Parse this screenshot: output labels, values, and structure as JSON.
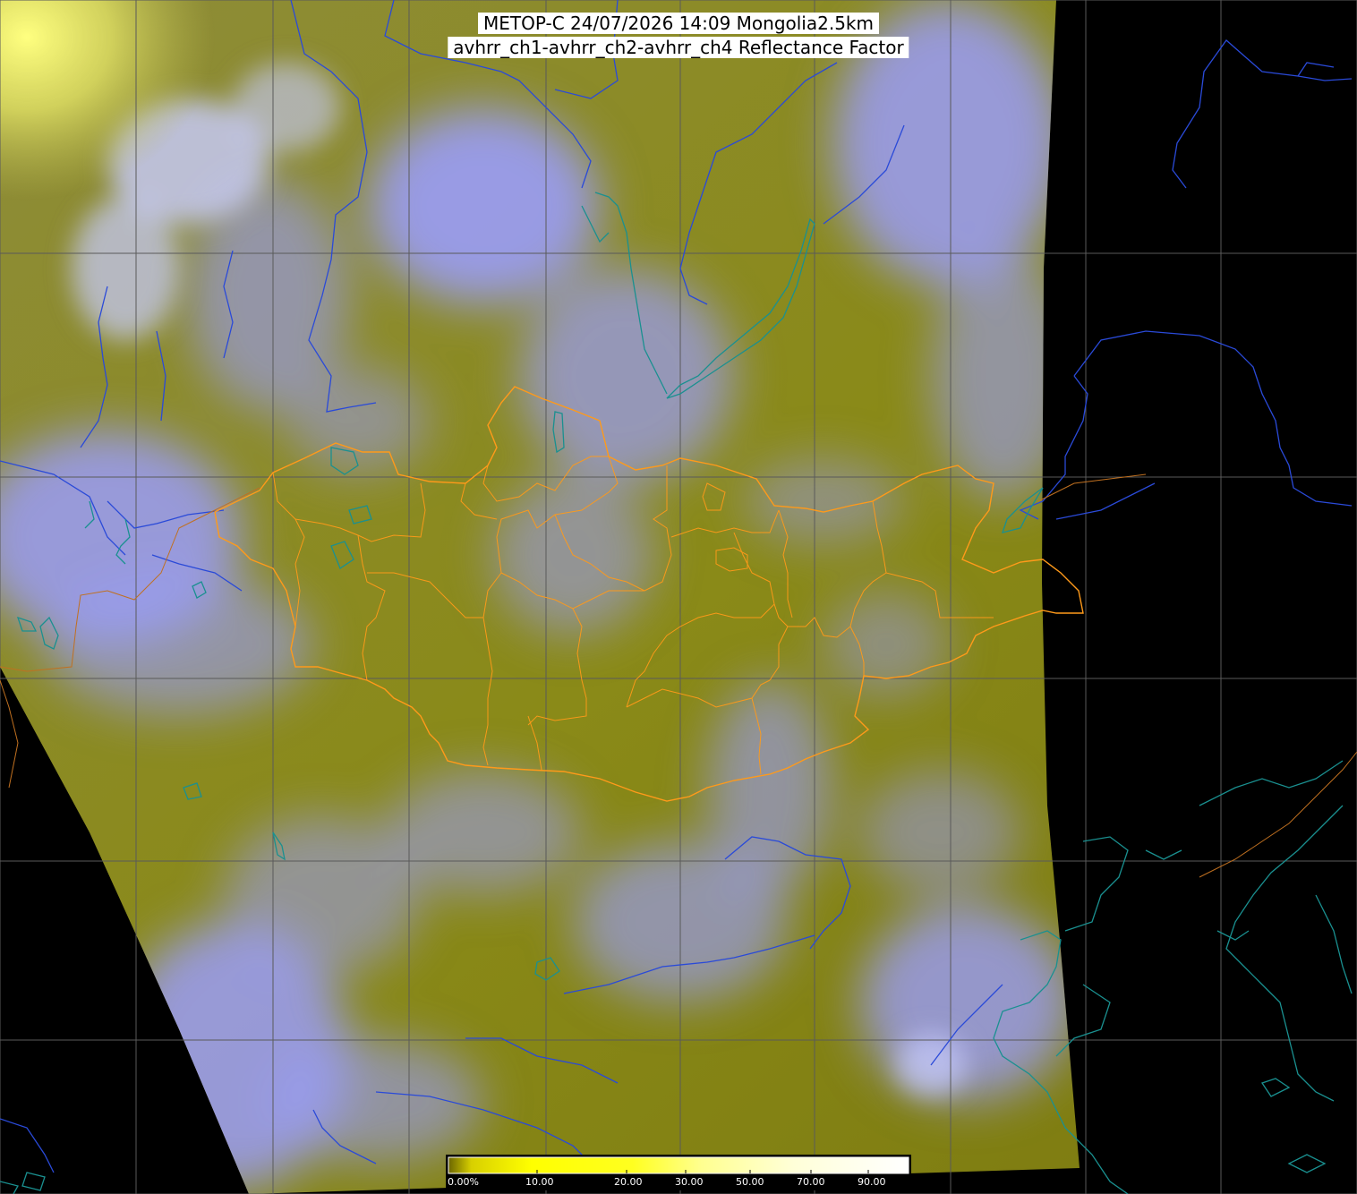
{
  "title": {
    "line1": "METOP-C 24/07/2026 14:09 Mongolia2.5km",
    "line2": "avhrr_ch1-avhrr_ch2-avhrr_ch4 Reflectance Factor"
  },
  "colorbar": {
    "labels": [
      "0.00%",
      "10.00",
      "20.00",
      "30.00",
      "50.00",
      "70.00",
      "90.00"
    ],
    "colors": [
      "#6b6500",
      "#ffff00",
      "#ffff80",
      "#ffffc8",
      "#ffffff"
    ]
  },
  "colors": {
    "background": "#000000",
    "land_clear": "#8a8a10",
    "cloud": "#9a9cf8",
    "sunglint": "#f0f060",
    "grid": "#555555",
    "mongolia_border": "#ff9a1a",
    "rivers": "#2a4ad0",
    "coastline": "#1a8a8a"
  }
}
